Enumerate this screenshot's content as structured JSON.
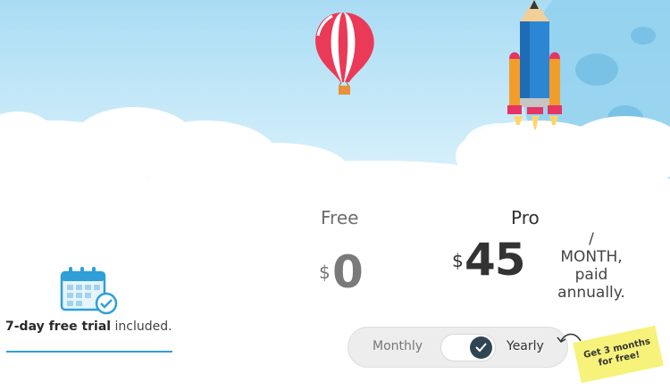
{
  "plans": {
    "free": {
      "name": "Free",
      "currency": "$",
      "amount": "0"
    },
    "pro": {
      "name": "Pro",
      "currency": "$",
      "amount": "45",
      "period_slash": "/",
      "period_line1": "MONTH,",
      "period_line2": "paid",
      "period_line3": "annually."
    }
  },
  "trial": {
    "bold": "7-day free trial",
    "rest": " included.",
    "icon": "calendar-check-icon"
  },
  "billing_toggle": {
    "left_label": "Monthly",
    "right_label": "Yearly",
    "selected": "Yearly"
  },
  "promo": {
    "line1": "Get 3 months",
    "line2": "for free!"
  },
  "colors": {
    "accent": "#2f9fd8",
    "toggle_knob": "#2f4553",
    "promo_bg": "#f6f27a",
    "sky": "#bfe6f7"
  }
}
